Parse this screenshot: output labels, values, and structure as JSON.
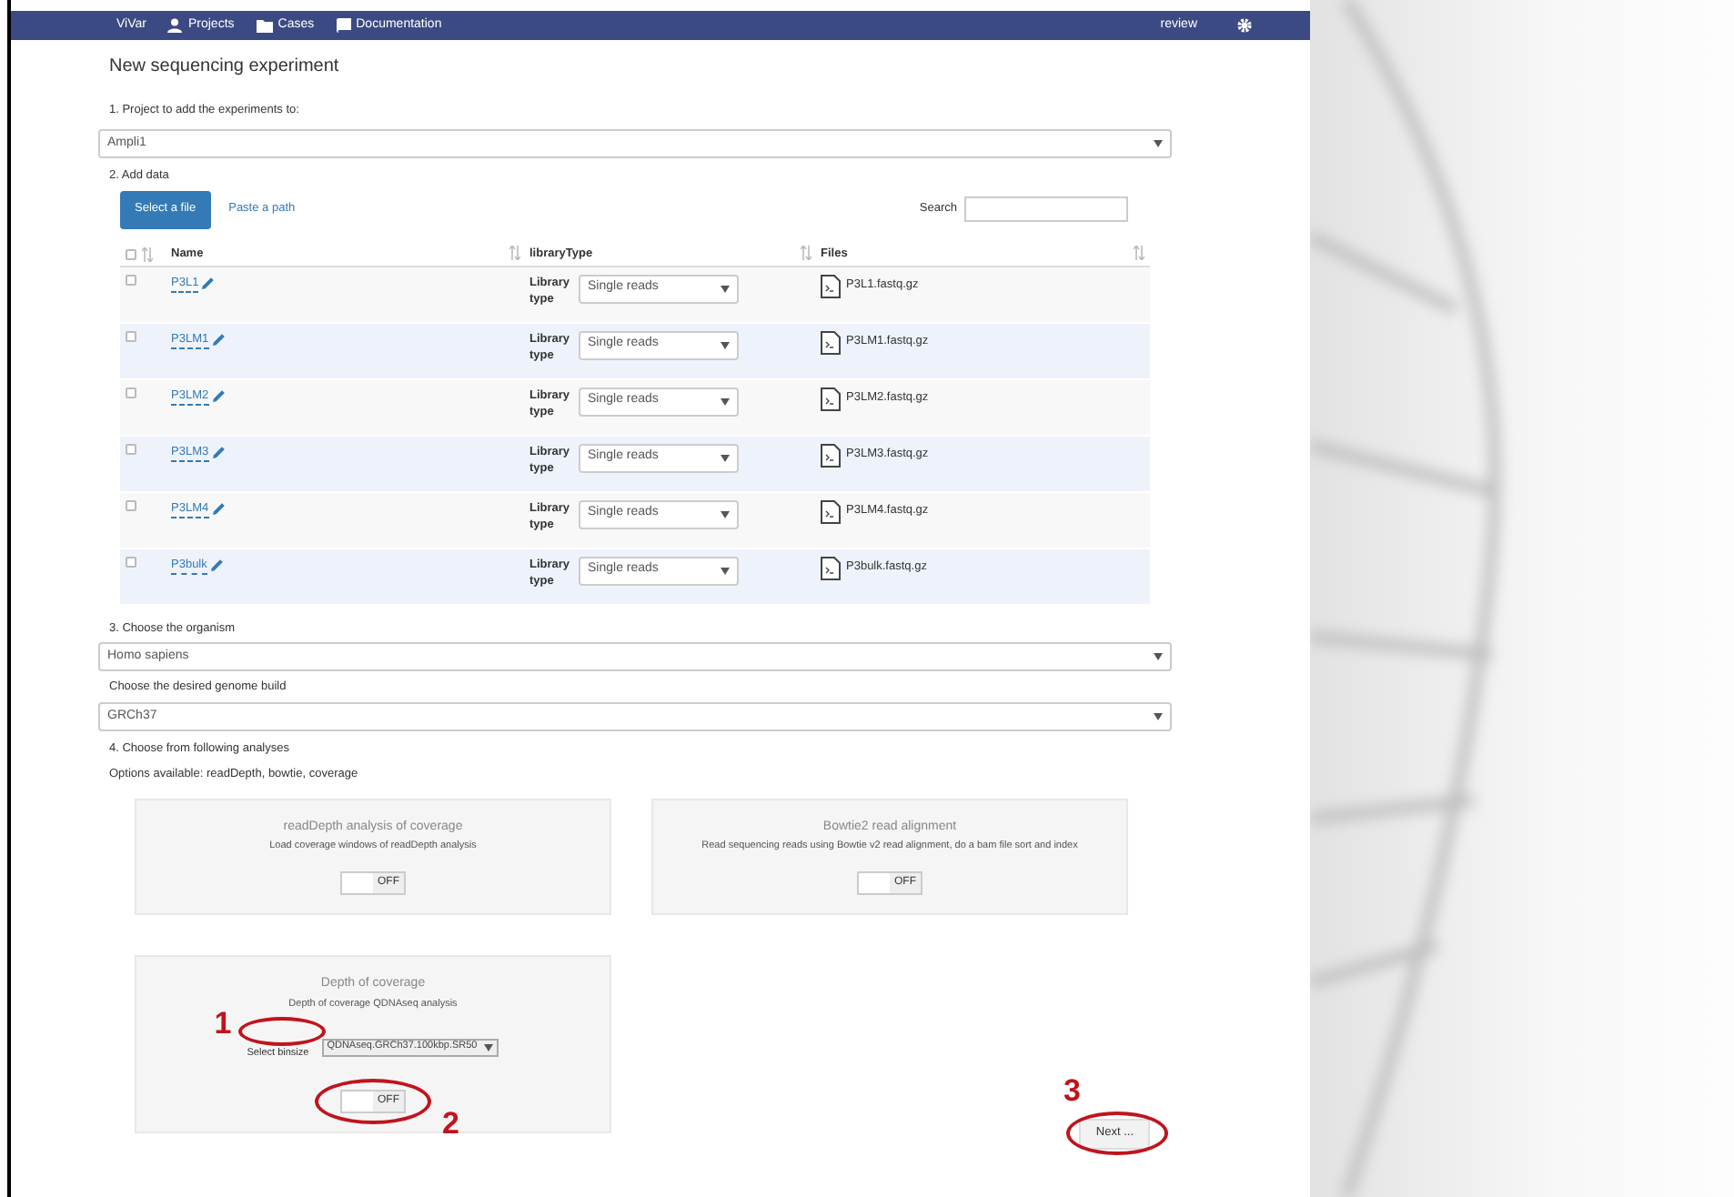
{
  "nav": {
    "brand": "ViVar",
    "items": [
      {
        "label": "Projects",
        "kind": "person"
      },
      {
        "label": "Cases",
        "kind": "folder"
      },
      {
        "label": "Documentation",
        "kind": "book"
      }
    ],
    "user": "review"
  },
  "title": "New sequencing experiment",
  "project": {
    "label": "1. Project to add the experiments to:",
    "value": "Ampli1"
  },
  "add_data": {
    "label": "2. Add data",
    "tabs": [
      {
        "label": "Select a file",
        "selected": true
      },
      {
        "label": "Paste a path",
        "selected": false
      }
    ],
    "search_label": "Search"
  },
  "table": {
    "all_checked": false,
    "columns": [
      "Name",
      "libraryType",
      "Files"
    ],
    "rows": [
      {
        "name": "P3L1",
        "checked": false,
        "library_label": "Library type",
        "library": "Single reads",
        "file": "P3L1.fastq.gz"
      },
      {
        "name": "P3LM1",
        "checked": false,
        "library_label": "Library type",
        "library": "Single reads",
        "file": "P3LM1.fastq.gz"
      },
      {
        "name": "P3LM2",
        "checked": false,
        "library_label": "Library type",
        "library": "Single reads",
        "file": "P3LM2.fastq.gz"
      },
      {
        "name": "P3LM3",
        "checked": false,
        "library_label": "Library type",
        "library": "Single reads",
        "file": "P3LM3.fastq.gz"
      },
      {
        "name": "P3LM4",
        "checked": false,
        "library_label": "Library type",
        "library": "Single reads",
        "file": "P3LM4.fastq.gz"
      },
      {
        "name": "P3bulk",
        "checked": false,
        "library_label": "Library type",
        "library": "Single reads",
        "file": "P3bulk.fastq.gz"
      }
    ]
  },
  "organism": {
    "label": "3. Choose the organism",
    "value": "Homo sapiens"
  },
  "genome": {
    "label": "Choose the desired genome build",
    "value": "GRCh37"
  },
  "analyses": {
    "label": "4. Choose from following analyses",
    "options": "Options available: readDepth, bowtie, coverage",
    "cards": [
      {
        "title": "readDepth analysis of coverage",
        "description": "Load coverage windows of readDepth analysis",
        "toggle": "OFF",
        "on": false
      },
      {
        "title": "Bowtie2 read alignment",
        "description": "Read sequencing reads using Bowtie v2 read alignment, do a bam file sort and index",
        "toggle": "OFF",
        "on": false
      },
      {
        "title": "Depth of coverage",
        "description": "Depth of coverage QDNAseq analysis",
        "select_label": "Select binsize",
        "select_value": "QDNAseq.GRCh37.100kbp.SR50",
        "label_annotation": "1",
        "toggle": "OFF",
        "on": false,
        "toggle_annotation": "2"
      }
    ]
  },
  "next": {
    "label": "Next ...",
    "annotation": "3"
  }
}
